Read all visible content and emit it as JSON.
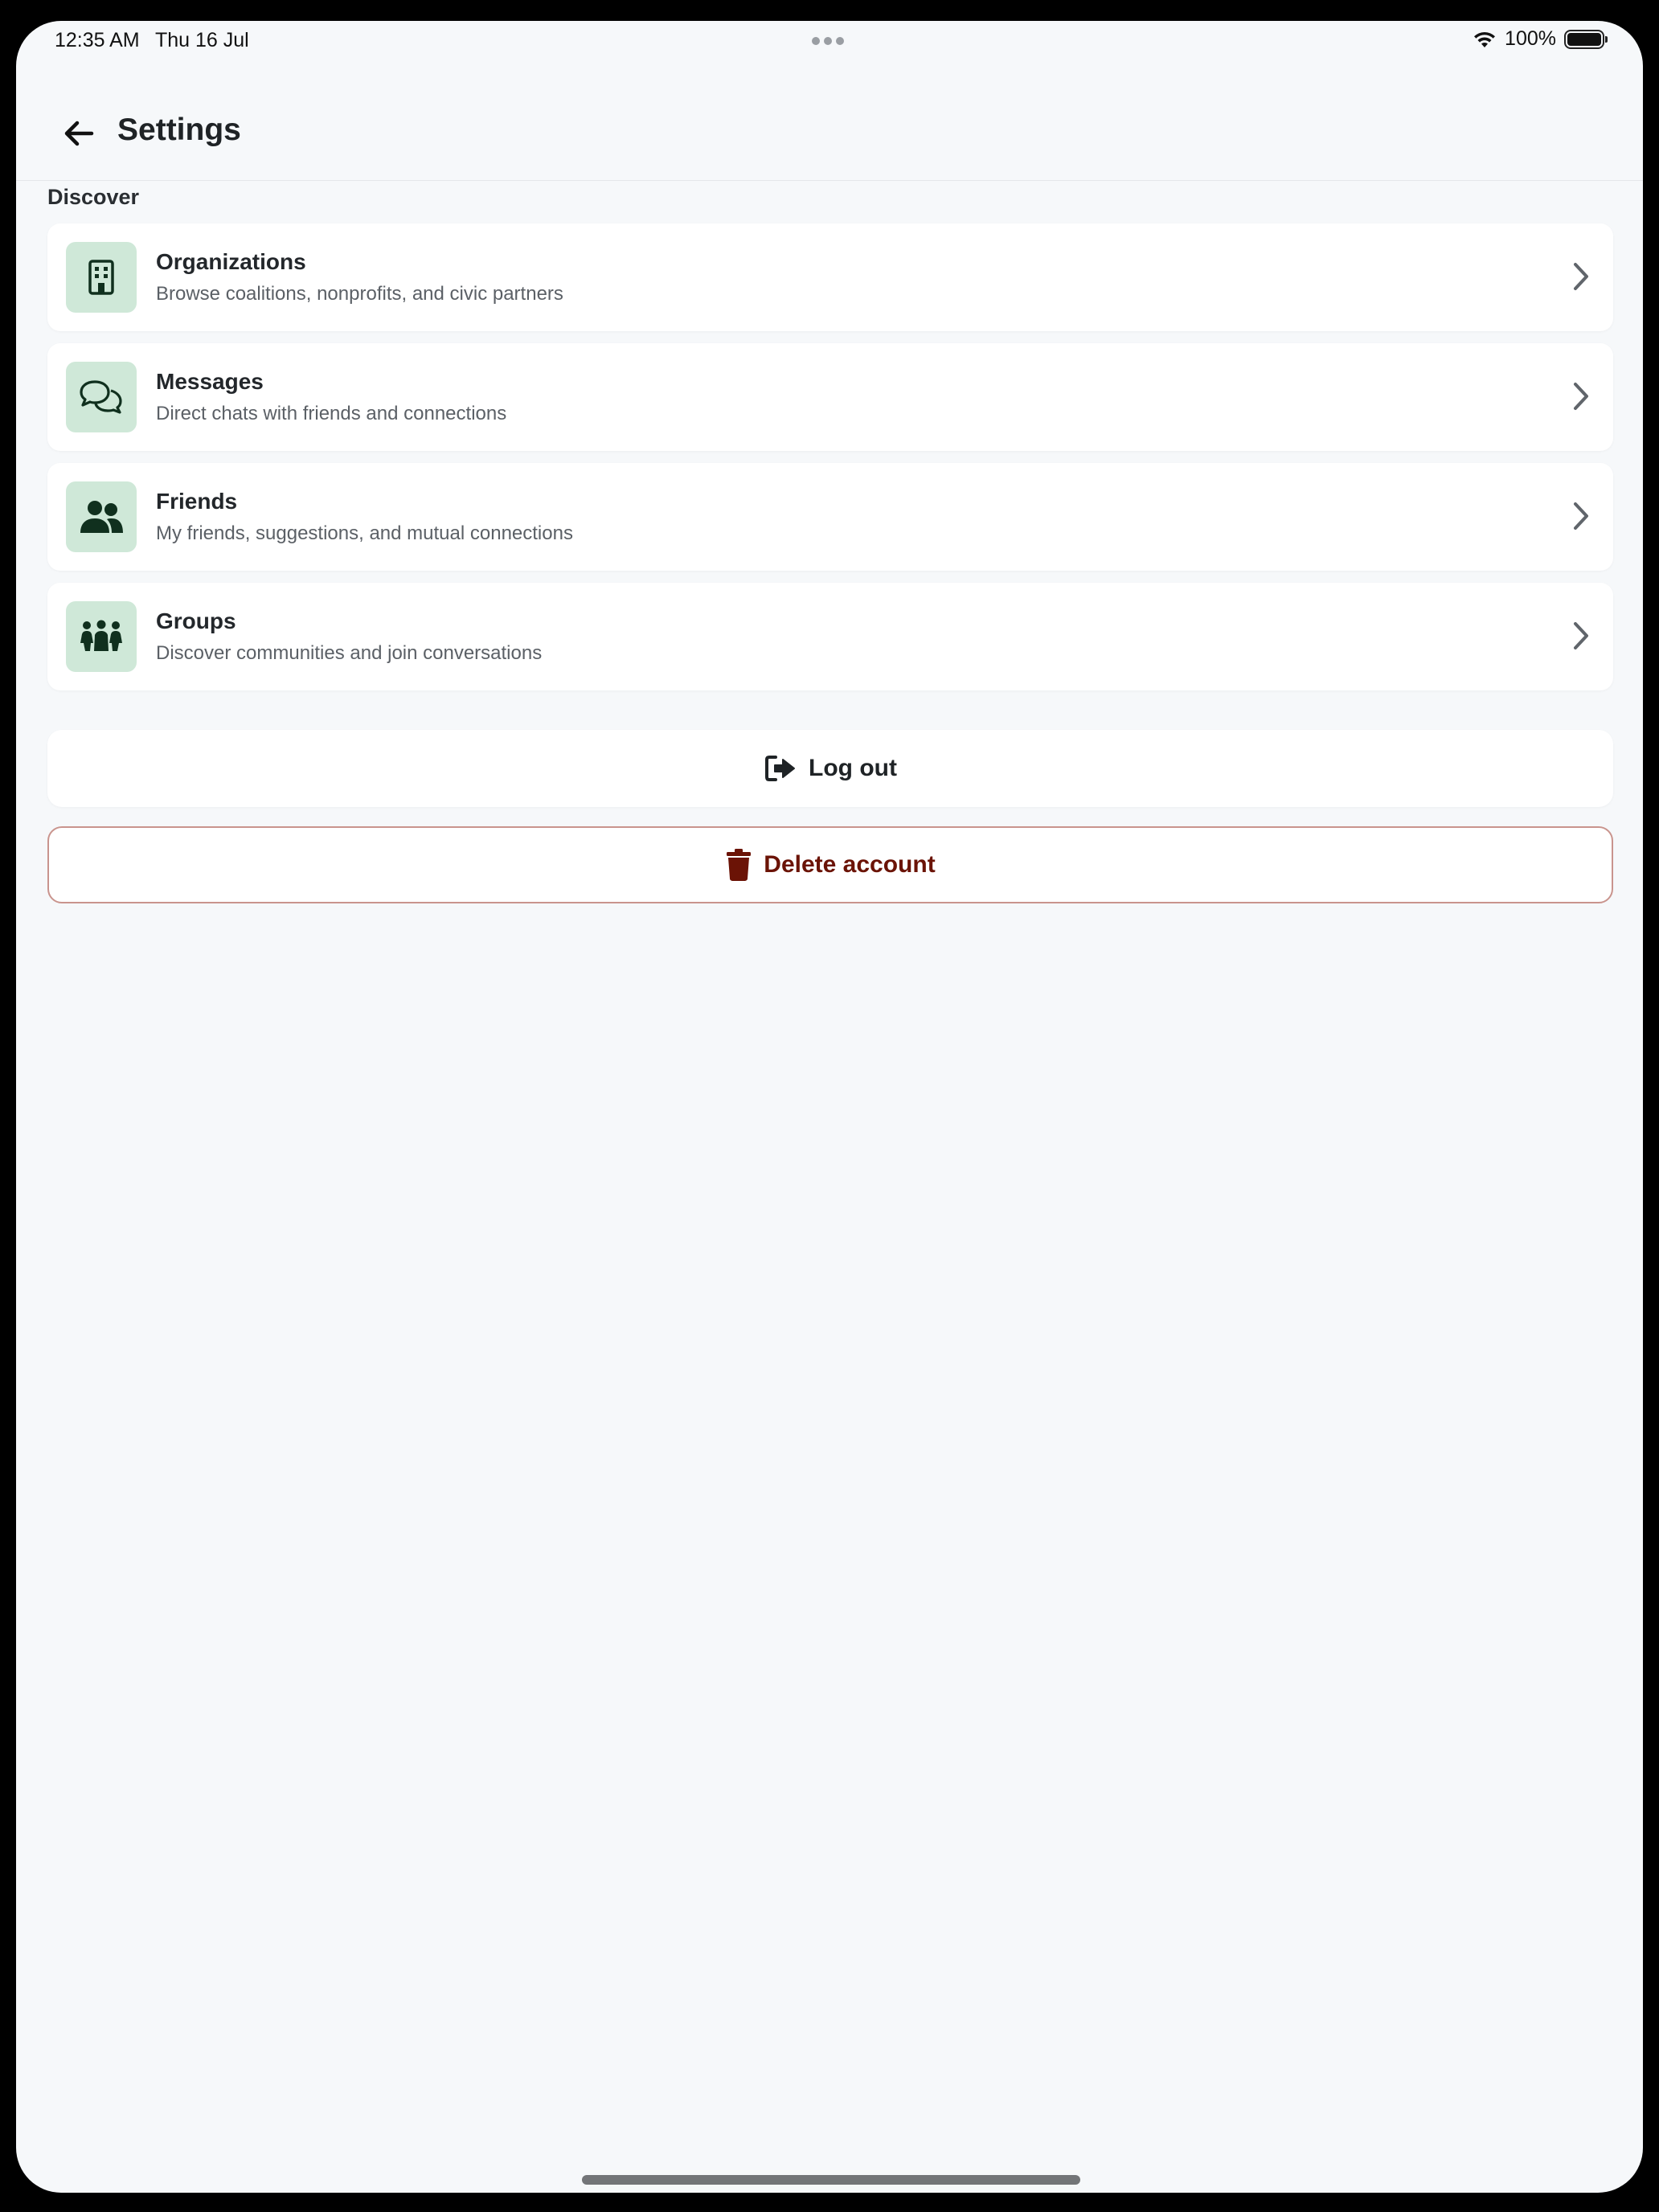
{
  "status_bar": {
    "time": "12:35 AM",
    "date": "Thu 16 Jul",
    "battery": "100%",
    "wifi_icon": "wifi-icon",
    "battery_icon": "battery-icon"
  },
  "header": {
    "title": "Settings",
    "back_icon": "arrow-left-icon"
  },
  "section": {
    "label": "Discover"
  },
  "items": [
    {
      "title": "Organizations",
      "subtitle": "Browse coalitions, nonprofits, and civic partners",
      "icon": "building-icon"
    },
    {
      "title": "Messages",
      "subtitle": "Direct chats with friends and connections",
      "icon": "chat-bubbles-icon"
    },
    {
      "title": "Friends",
      "subtitle": "My friends, suggestions, and mutual connections",
      "icon": "user-friends-icon"
    },
    {
      "title": "Groups",
      "subtitle": "Discover communities and join conversations",
      "icon": "people-group-icon"
    }
  ],
  "actions": {
    "logout_label": "Log out",
    "logout_icon": "sign-out-icon",
    "delete_label": "Delete account",
    "delete_icon": "trash-icon"
  },
  "colors": {
    "background": "#f6f8fa",
    "icon_tile": "#cfe8d8",
    "icon_glyph": "#10301e",
    "danger_text": "#6b1306",
    "danger_border": "#c9948d"
  }
}
